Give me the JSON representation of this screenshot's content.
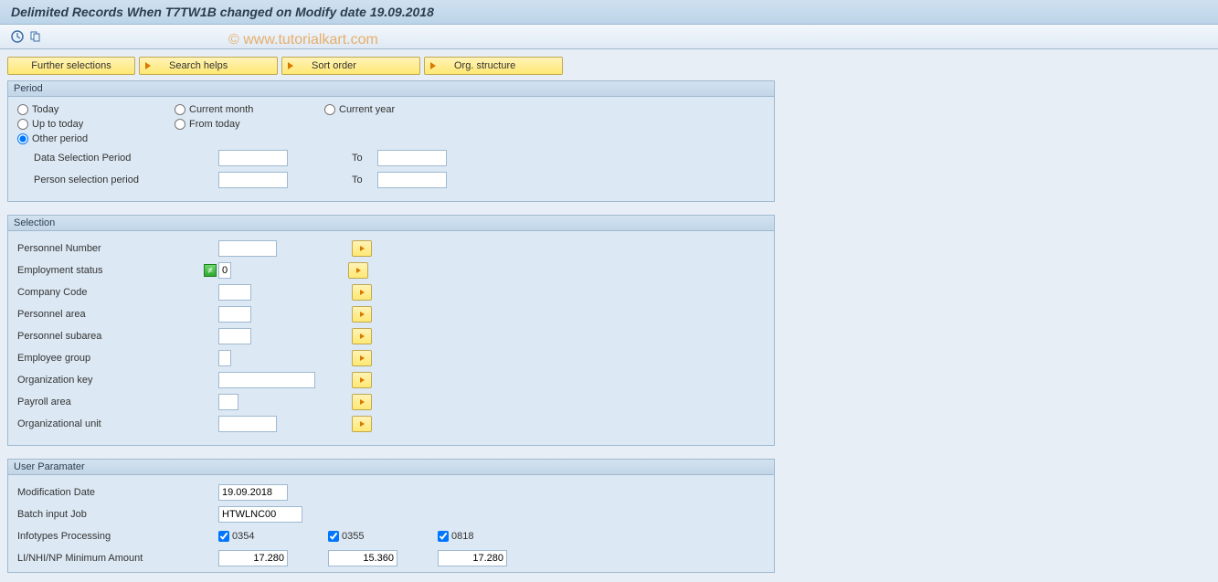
{
  "title": "Delimited Records When T7TW1B changed on Modify date 19.09.2018",
  "watermark": "© www.tutorialkart.com",
  "buttons": {
    "further": "Further selections",
    "search": "Search helps",
    "sort": "Sort order",
    "org": "Org. structure"
  },
  "period": {
    "header": "Period",
    "today": "Today",
    "current_month": "Current month",
    "current_year": "Current year",
    "up_to_today": "Up to today",
    "from_today": "From today",
    "other_period": "Other period",
    "data_selection": "Data Selection Period",
    "person_selection": "Person selection period",
    "to": "To"
  },
  "selection": {
    "header": "Selection",
    "personnel_number": "Personnel Number",
    "employment_status": "Employment status",
    "employment_status_val": "0",
    "company_code": "Company Code",
    "personnel_area": "Personnel area",
    "personnel_subarea": "Personnel subarea",
    "employee_group": "Employee group",
    "organization_key": "Organization key",
    "payroll_area": "Payroll area",
    "organizational_unit": "Organizational unit"
  },
  "user_param": {
    "header": "User Paramater",
    "modification_date": "Modification Date",
    "modification_date_val": "19.09.2018",
    "batch_input": "Batch input Job",
    "batch_input_val": "HTWLNC00",
    "infotypes": "Infotypes Processing",
    "infotype1": "0354",
    "infotype2": "0355",
    "infotype3": "0818",
    "min_amount": "LI/NHI/NP Minimum Amount",
    "min1": "17.280",
    "min2": "15.360",
    "min3": "17.280"
  }
}
